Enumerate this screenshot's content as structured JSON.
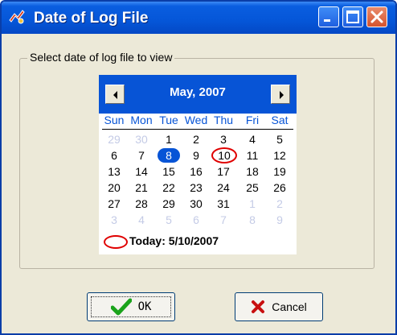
{
  "window": {
    "title": "Date of Log File",
    "accent": "#0754d6"
  },
  "group": {
    "label": "Select date of log file to view"
  },
  "calendar": {
    "month_title": "May, 2007",
    "days_of_week": [
      "Sun",
      "Mon",
      "Tue",
      "Wed",
      "Thu",
      "Fri",
      "Sat"
    ],
    "weeks": [
      [
        "29",
        "30",
        "1",
        "2",
        "3",
        "4",
        "5"
      ],
      [
        "6",
        "7",
        "8",
        "9",
        "10",
        "11",
        "12"
      ],
      [
        "13",
        "14",
        "15",
        "16",
        "17",
        "18",
        "19"
      ],
      [
        "20",
        "21",
        "22",
        "23",
        "24",
        "25",
        "26"
      ],
      [
        "27",
        "28",
        "29",
        "30",
        "31",
        "1",
        "2"
      ],
      [
        "3",
        "4",
        "5",
        "6",
        "7",
        "8",
        "9"
      ]
    ],
    "selected_day": "8",
    "today_day": "10",
    "today_label": "Today: 5/10/2007"
  },
  "buttons": {
    "ok_label": "OK",
    "cancel_label": "Cancel"
  }
}
